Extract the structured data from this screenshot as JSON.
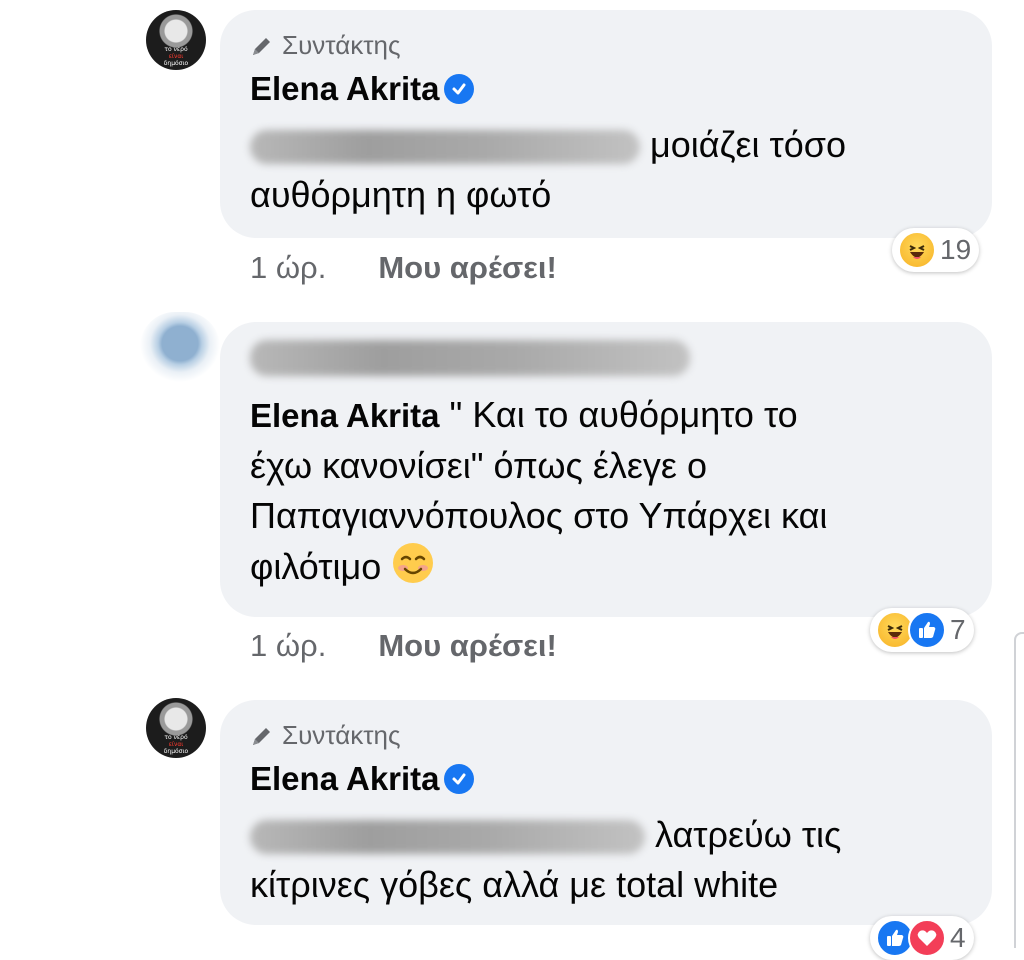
{
  "comments": [
    {
      "role_label": "Συντάκτης",
      "author": "Elena Akrita",
      "text_after_redaction": "μοιάζει τόσο",
      "text_line2": "αυθόρμητη η φωτό",
      "time": "1 ώρ.",
      "like_label": "Μου αρέσει!",
      "reaction_count": "19",
      "reactions": [
        "haha-icon"
      ]
    },
    {
      "author": "Elena Akrita",
      "text_line1": " \" Και το αυθόρμητο το",
      "text_line2": "έχω κανονίσει\" όπως έλεγε ο",
      "text_line3": "Παπαγιαννόπουλος στο Υπάρχει και",
      "text_line4": "φιλότιμο",
      "time": "1 ώρ.",
      "like_label": "Μου αρέσει!",
      "reaction_count": "7",
      "reactions": [
        "haha-icon",
        "like-icon"
      ]
    },
    {
      "role_label": "Συντάκτης",
      "author": "Elena Akrita",
      "text_after_redaction": "λατρεύω τις",
      "text_line2": "κίτρινες γόβες αλλά με total white",
      "reaction_count": "4",
      "reactions": [
        "like-icon",
        "love-icon"
      ]
    }
  ],
  "avatar_text": {
    "l1": "το νερό",
    "l2": "είναι",
    "l3": "δημόσιο"
  },
  "colors": {
    "bubble": "#f0f2f5",
    "meta": "#65676b",
    "verified": "#1877f2",
    "haha": "#f7b125",
    "like": "#1877f2",
    "love": "#f33e58"
  }
}
